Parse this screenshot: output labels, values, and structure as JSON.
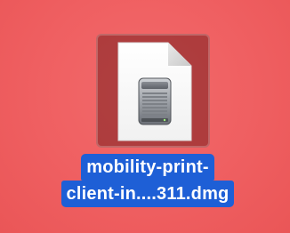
{
  "desktop": {
    "background_color": "#ef5f61",
    "selected_item": {
      "icon": "dmg-disk-image-icon",
      "filename_lines": [
        "mobility-print-",
        "client-in....311.dmg"
      ],
      "selection_color": "#1e5fd6"
    }
  }
}
